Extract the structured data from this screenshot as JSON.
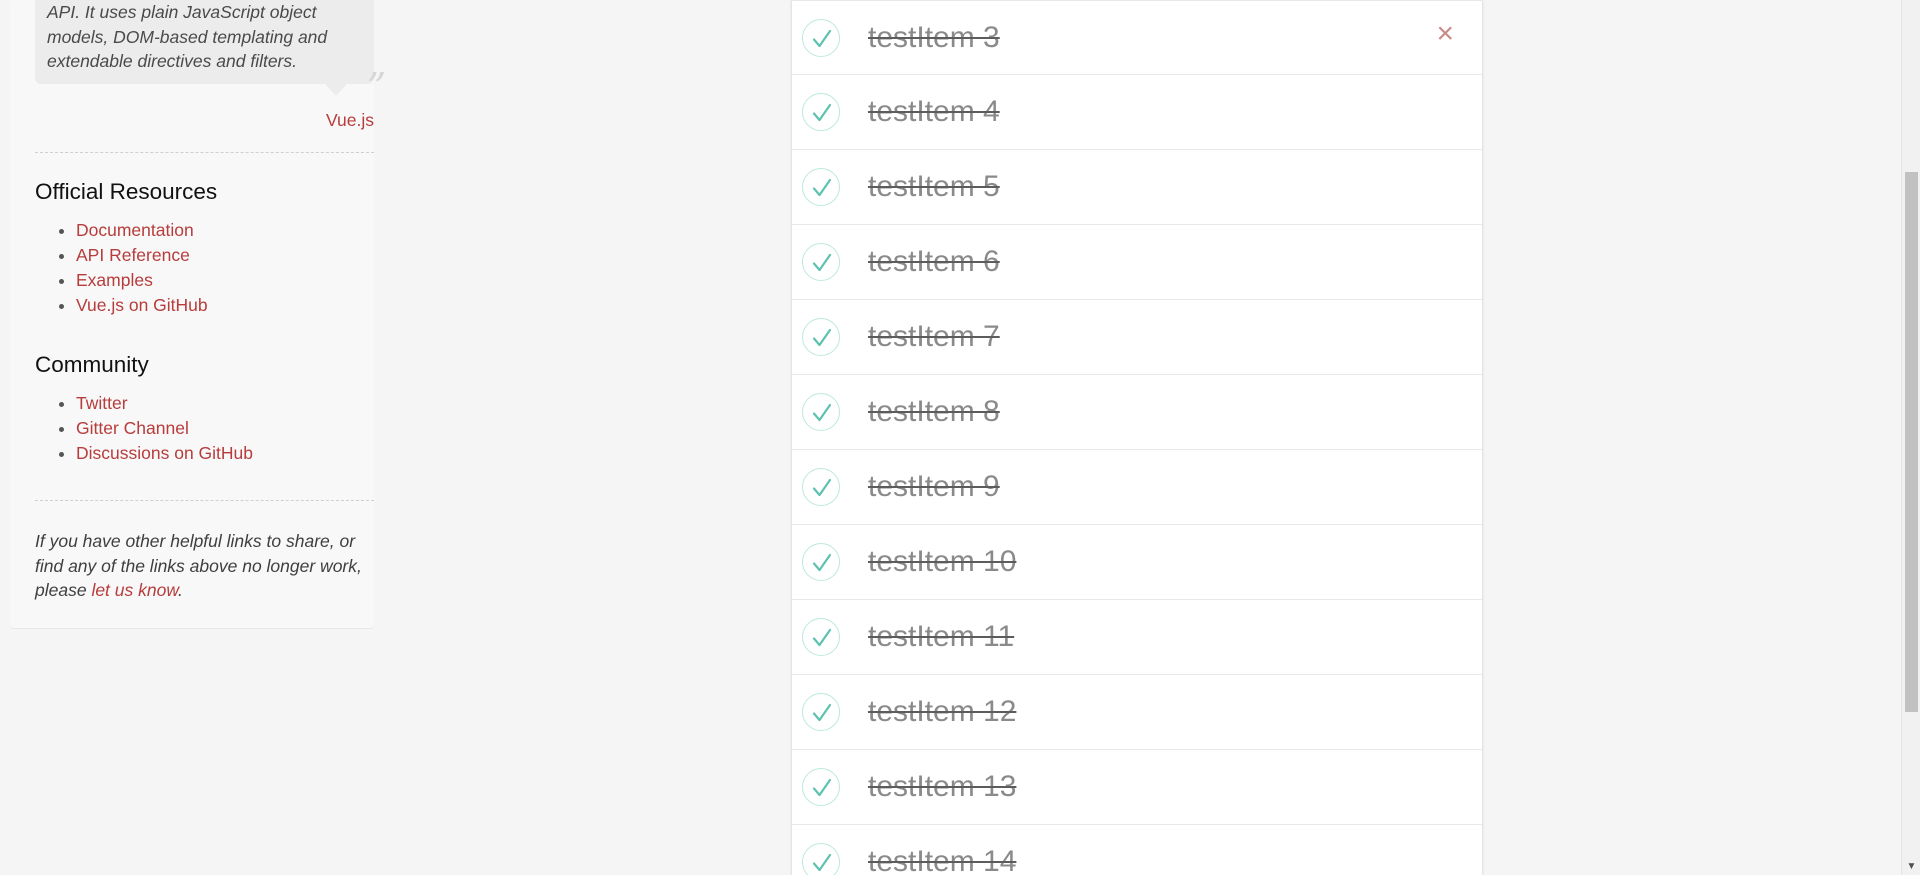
{
  "sidebar": {
    "quote_text": "API. It uses plain JavaScript object models, DOM-based templating and extendable directives and filters.",
    "quote_source": "Vue.js",
    "official": {
      "title": "Official Resources",
      "links": [
        "Documentation",
        "API Reference",
        "Examples",
        "Vue.js on GitHub"
      ]
    },
    "community": {
      "title": "Community",
      "links": [
        "Twitter",
        "Gitter Channel",
        "Discussions on GitHub"
      ]
    },
    "note": {
      "prefix": "If you have other helpful links to share, or find any of the links above no longer work, please ",
      "link": "let us know",
      "suffix": "."
    }
  },
  "todos": {
    "items": [
      {
        "label": "testItem 3",
        "completed": true
      },
      {
        "label": "testItem 4",
        "completed": true
      },
      {
        "label": "testItem 5",
        "completed": true
      },
      {
        "label": "testItem 6",
        "completed": true
      },
      {
        "label": "testItem 7",
        "completed": true
      },
      {
        "label": "testItem 8",
        "completed": true
      },
      {
        "label": "testItem 9",
        "completed": true
      },
      {
        "label": "testItem 10",
        "completed": true
      },
      {
        "label": "testItem 11",
        "completed": true
      },
      {
        "label": "testItem 12",
        "completed": true
      },
      {
        "label": "testItem 13",
        "completed": true
      },
      {
        "label": "testItem 14",
        "completed": true
      }
    ],
    "destroy_icon": "×",
    "colors": {
      "check": "#5dc2af",
      "check_border": "#bde9dc",
      "destroy": "#c98a88",
      "link": "#b73c3c"
    }
  },
  "scrollbar": {
    "down_arrow": "▼"
  }
}
